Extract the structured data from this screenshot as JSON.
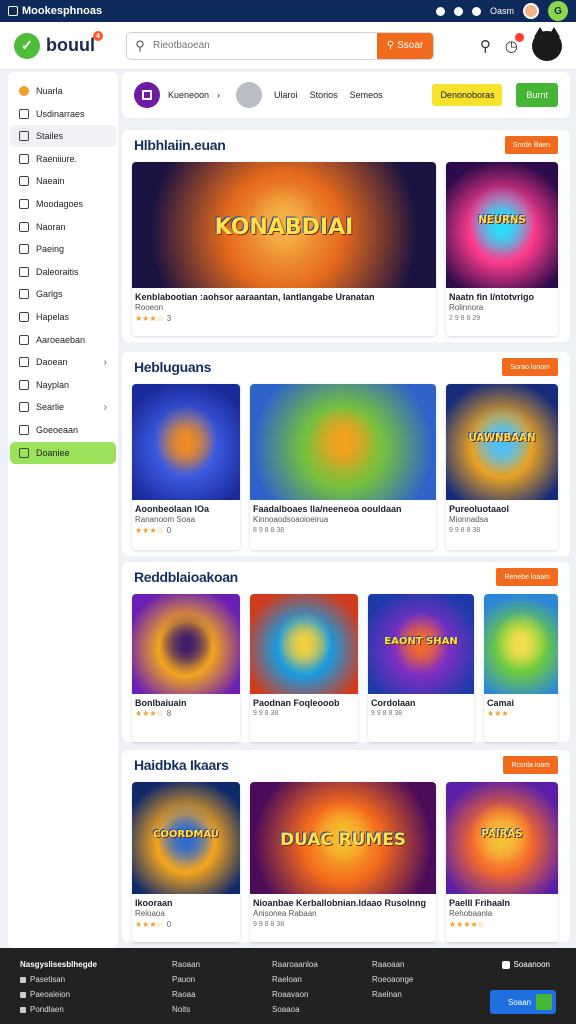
{
  "topbar": {
    "brand": "Mookesphnoas",
    "user": "Oasm",
    "badge": "G"
  },
  "header": {
    "logo": "bouul",
    "logo_badge": "4",
    "search_placeholder": "Rieotbaoean",
    "search_button": "Ssoar"
  },
  "sidebar": {
    "items": [
      {
        "label": "Nuarla",
        "chevron": ""
      },
      {
        "label": "Usdinarraes",
        "chevron": ""
      },
      {
        "label": "Stailes",
        "chevron": ""
      },
      {
        "label": "Raeniiure.",
        "chevron": ""
      },
      {
        "label": "Naeain",
        "chevron": ""
      },
      {
        "label": "Moodagoes",
        "chevron": ""
      },
      {
        "label": "Naoran",
        "chevron": ""
      },
      {
        "label": "Paeing",
        "chevron": ""
      },
      {
        "label": "Daleoraitis",
        "chevron": ""
      },
      {
        "label": "Garlgs",
        "chevron": ""
      },
      {
        "label": "Hapelas",
        "chevron": ""
      },
      {
        "label": "Aaroeaeban",
        "chevron": ""
      },
      {
        "label": "Daoean",
        "chevron": "›"
      },
      {
        "label": "Nayplan",
        "chevron": ""
      },
      {
        "label": "Searlie",
        "chevron": "›"
      },
      {
        "label": "Goeoeaan",
        "chevron": ""
      },
      {
        "label": "Doaniee",
        "chevron": ""
      }
    ]
  },
  "breadcrumb": {
    "item1": "Kueneoon",
    "sep": "›",
    "item2": "Ularoi",
    "item3": "Storios",
    "item4": "Semeos",
    "btn_yellow": "Denonoboras",
    "btn_green": "Burnt"
  },
  "sections": [
    {
      "title": "Hlbhlaiin.euan",
      "button": "Snrde illaen",
      "cards": [
        {
          "art": "KONABDIAI",
          "title": "Kenblabootian :aohsor aaraantan, Iantlangabe Uranatan",
          "sub": "Rooeon",
          "stars": "★★★☆",
          "num": "3",
          "meta": ""
        },
        {
          "art": "NEURNS",
          "title": "Naatn fin l/ntotvrigo",
          "sub": "Rolinnora",
          "stars": "",
          "num": "",
          "meta": "2 9 8 8 29"
        }
      ]
    },
    {
      "title": "Hebluguans",
      "button": "Sorao lonom",
      "cards": [
        {
          "art": "",
          "title": "Aoonbeolaan lOa",
          "sub": "Rananoom Soaa",
          "stars": "★★★☆",
          "num": "0",
          "meta": ""
        },
        {
          "art": "",
          "title": "Faadalboaes lla/neeneoa oouldaan",
          "sub": "Kinnoaodsoaoioeirua",
          "stars": "",
          "num": "",
          "meta": "8 9 8 8 38"
        },
        {
          "art": "UAWNBAAN",
          "title": "Pureoluotaaol",
          "sub": "Mionnadsa",
          "stars": "",
          "num": "",
          "meta": "9 9 8 8 38"
        }
      ]
    },
    {
      "title": "Reddblaioakoan",
      "button": "Renebe loaam",
      "cards": [
        {
          "art": "",
          "title": "Bonlbaiuain",
          "sub": "",
          "stars": "★★★☆",
          "num": "8",
          "meta": ""
        },
        {
          "art": "",
          "title": "Paodnan Foqleooob",
          "sub": "",
          "stars": "",
          "num": "",
          "meta": "9 9 8 38"
        },
        {
          "art": "EAONT SHAN",
          "title": "Cordolaan",
          "sub": "",
          "stars": "",
          "num": "",
          "meta": "9 9 8 8 38"
        },
        {
          "art": "",
          "title": "Camai",
          "sub": "",
          "stars": "★★★",
          "num": "",
          "meta": ""
        }
      ]
    },
    {
      "title": "Haidbka Ikaars",
      "button": "Rcsnla ioam",
      "cards": [
        {
          "art": "COORDMAU",
          "title": "Ikooraan",
          "sub": "Reloaoa",
          "stars": "★★★☆",
          "num": "0",
          "meta": ""
        },
        {
          "art": "DUAC RUMES",
          "title": "Nioanbae Kerballobnian.ldaao Rusolnng",
          "sub": "Anisonea Rabaan",
          "stars": "",
          "num": "",
          "meta": "9 9 8 8 38"
        },
        {
          "art": "PAIRAS",
          "title": "Paelll Frihaaln",
          "sub": "Rehobaanla",
          "stars": "★★★★☆",
          "num": "",
          "meta": ""
        }
      ]
    }
  ],
  "footer": {
    "col1_title": "Nasgyslisesblhegde",
    "col1_items": [
      "Pasetisan",
      "Paeoaleion",
      "Pondlaen"
    ],
    "col2": [
      "Raoaan",
      "Pauon",
      "Raoaa",
      "Noits"
    ],
    "col3": [
      "Raaroaanloa",
      "Raeloan",
      "Roaavaon",
      "Soaaoa"
    ],
    "col4": [
      "Raaoaan",
      "Roeoaonge",
      "Raelnan"
    ],
    "social": "Soaanoon",
    "button": "Soaan"
  }
}
